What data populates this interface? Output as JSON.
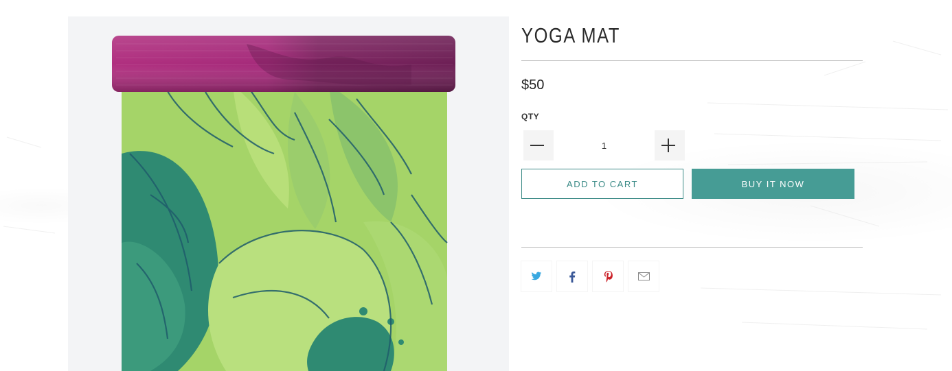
{
  "product": {
    "title": "YOGA MAT",
    "price": "$50",
    "image_alt": "Yoga mat with green floral print and magenta rolled top"
  },
  "quantity": {
    "label": "QTY",
    "value": "1",
    "decrement_icon": "minus-icon",
    "increment_icon": "plus-icon"
  },
  "actions": {
    "add_to_cart": "Add to Cart",
    "buy_it_now": "Buy it now"
  },
  "share": [
    {
      "name": "twitter",
      "icon": "twitter-icon",
      "color": "#39a8e0"
    },
    {
      "name": "facebook",
      "icon": "facebook-icon",
      "color": "#3b5998"
    },
    {
      "name": "pinterest",
      "icon": "pinterest-icon",
      "color": "#cb2027"
    },
    {
      "name": "email",
      "icon": "mail-icon",
      "color": "#8a8a8a"
    }
  ],
  "colors": {
    "accent": "#469c95",
    "accent_border": "#3a8a86",
    "divider": "#bdbdbd",
    "image_background": "#f3f4f6"
  }
}
